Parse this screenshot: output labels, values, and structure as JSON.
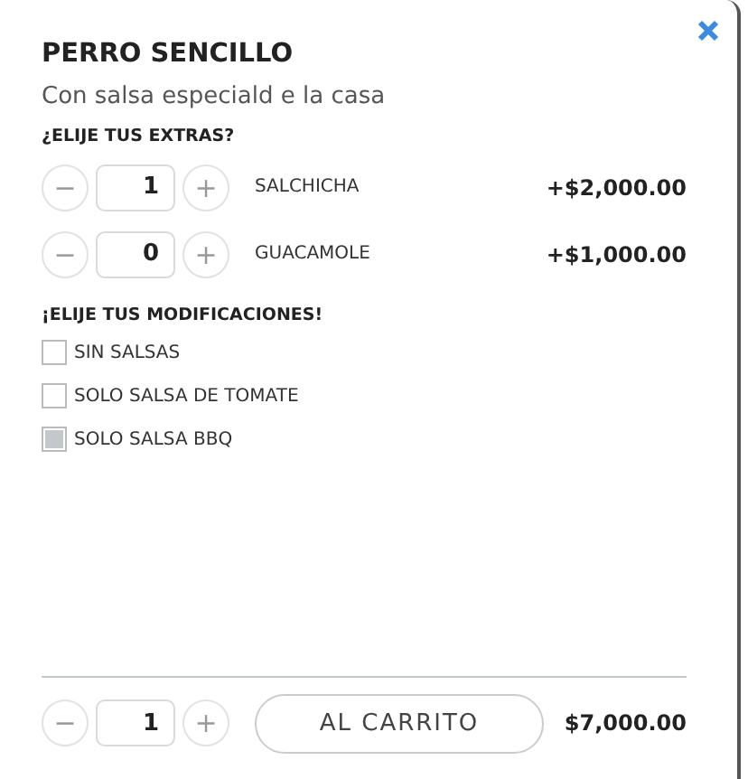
{
  "title": "PERRO SENCILLO",
  "description": "Con salsa especiald e la casa",
  "extras": {
    "heading": "¿ELIJE TUS EXTRAS?",
    "items": [
      {
        "minus": "−",
        "quantity": "1",
        "plus": "+",
        "name": "SALCHICHA",
        "price": "+$2,000.00"
      },
      {
        "minus": "−",
        "quantity": "0",
        "plus": "+",
        "name": "GUACAMOLE",
        "price": "+$1,000.00"
      }
    ]
  },
  "modifications": {
    "heading": "¡ELIJE TUS MODIFICACIONES!",
    "items": [
      {
        "label": "SIN SALSAS",
        "checked": false
      },
      {
        "label": "SOLO SALSA DE TOMATE",
        "checked": false
      },
      {
        "label": "SOLO SALSA BBQ",
        "checked": true
      }
    ]
  },
  "footer": {
    "minus": "−",
    "quantity": "1",
    "plus": "+",
    "button": "AL CARRITO",
    "total": "$7,000.00"
  }
}
